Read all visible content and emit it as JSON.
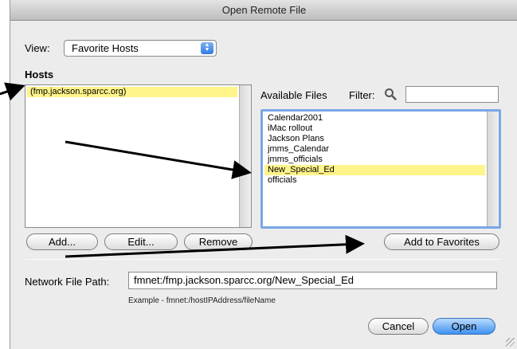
{
  "window": {
    "title": "Open Remote File"
  },
  "view": {
    "label": "View:",
    "selected": "Favorite Hosts",
    "arrows_icon": "popup-arrows-icon"
  },
  "hosts": {
    "label": "Hosts",
    "items": [
      "(fmp.jackson.sparcc.org)"
    ],
    "selected_index": 0
  },
  "files": {
    "label": "Available Files",
    "filter_label": "Filter:",
    "filter_value": "",
    "items": [
      "Calendar2001",
      "iMac rollout",
      "Jackson Plans",
      "jmms_Calendar",
      "jmms_officials",
      "New_Special_Ed",
      "officials"
    ],
    "selected_index": 5
  },
  "buttons": {
    "add": "Add...",
    "edit": "Edit...",
    "remove": "Remove",
    "add_favorites": "Add to Favorites",
    "cancel": "Cancel",
    "open": "Open"
  },
  "path": {
    "label": "Network File Path:",
    "value": "fmnet:/fmp.jackson.sparcc.org/New_Special_Ed",
    "example": "Example - fmnet:/hostIPAddress/fileName"
  },
  "colors": {
    "selection": "#fff48a",
    "default_button": "#3e91f0",
    "focus_ring": "#7aa7e6",
    "annotation_arrow": "#000000"
  }
}
